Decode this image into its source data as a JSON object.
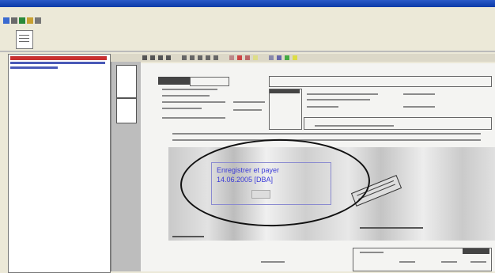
{
  "window": {
    "title_blur": "",
    "menu": [
      "",
      "",
      ""
    ]
  },
  "stamp": {
    "line1": "Enregistrer et payer",
    "line2": "14.06.2005 [DBA]"
  },
  "colors": {
    "titlebar": "#0a3aa8",
    "stamp_text": "#3a3ad8",
    "sidebar_header": "#c83030",
    "annotation_ellipse": "#111111"
  },
  "icons": [
    "app-icon",
    "toolbar-icon",
    "page-thumbnail-icon",
    "stamp-icon"
  ]
}
